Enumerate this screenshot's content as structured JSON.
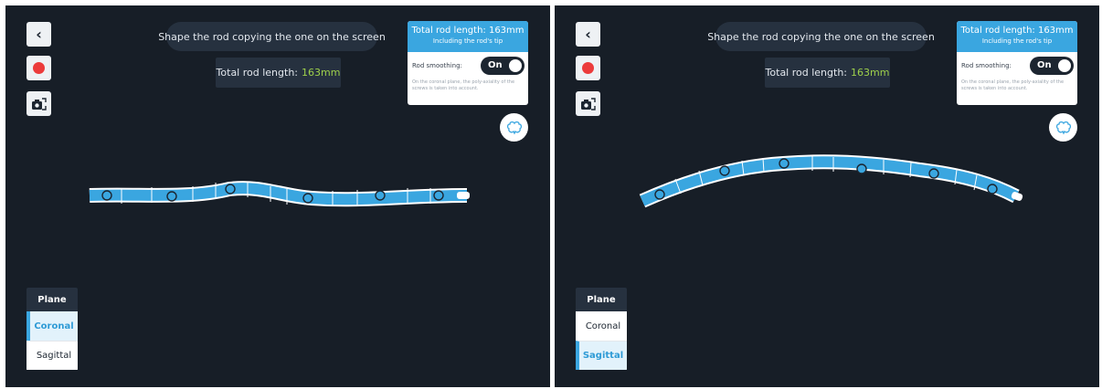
{
  "screens": [
    {
      "instruction": "Shape the rod copying the one on the screen",
      "length_label": "Total rod length:",
      "length_value": "163mm",
      "info": {
        "title": "Total rod length: 163mm",
        "subtitle": "Including the rod's tip",
        "smoothing_label": "Rod smoothing:",
        "toggle_label": "On",
        "note": "On the coronal plane, the poly-axiality of the screws is taken into account."
      },
      "plane": {
        "header": "Plane",
        "options": [
          "Coronal",
          "Sagittal"
        ],
        "selected": "Coronal"
      }
    },
    {
      "instruction": "Shape the rod copying the one on the screen",
      "length_label": "Total rod length:",
      "length_value": "163mm",
      "info": {
        "title": "Total rod length: 163mm",
        "subtitle": "Including the rod's tip",
        "smoothing_label": "Rod smoothing:",
        "toggle_label": "On",
        "note": "On the coronal plane, the poly-axiality of the screws is taken into account."
      },
      "plane": {
        "header": "Plane",
        "options": [
          "Coronal",
          "Sagittal"
        ],
        "selected": "Sagittal"
      }
    }
  ],
  "icons": {
    "back": "chevron-left-icon",
    "record": "record-icon",
    "camera": "camera-flip-icon",
    "brain": "brain-icon"
  },
  "colors": {
    "background": "#171e27",
    "panel": "#26313f",
    "accent": "#3aa6e0",
    "length_value": "#9ed04b",
    "record": "#ec3b3b"
  }
}
